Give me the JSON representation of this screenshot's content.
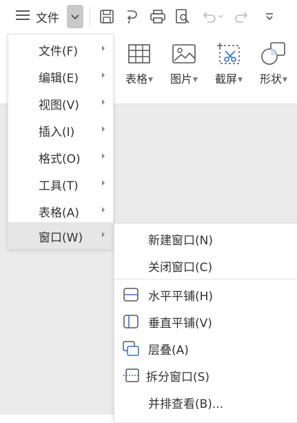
{
  "toolbar": {
    "menu_label": "文件"
  },
  "ribbon": {
    "items": [
      {
        "label": "表格"
      },
      {
        "label": "图片"
      },
      {
        "label": "截屏"
      },
      {
        "label": "形状"
      }
    ]
  },
  "menu": {
    "items": [
      {
        "label": "文件(F)"
      },
      {
        "label": "编辑(E)"
      },
      {
        "label": "视图(V)"
      },
      {
        "label": "插入(I)"
      },
      {
        "label": "格式(O)"
      },
      {
        "label": "工具(T)"
      },
      {
        "label": "表格(A)"
      },
      {
        "label": "窗口(W)"
      }
    ]
  },
  "submenu": {
    "items": [
      {
        "label": "新建窗口(N)"
      },
      {
        "label": "关闭窗口(C)"
      },
      {
        "label": "水平平铺(H)",
        "icon": "horizontal-tile-icon"
      },
      {
        "label": "垂直平铺(V)",
        "icon": "vertical-tile-icon"
      },
      {
        "label": "层叠(A)",
        "icon": "cascade-icon"
      },
      {
        "label": "拆分窗口(S)",
        "icon": "split-window-icon"
      },
      {
        "label": "并排查看(B)..."
      }
    ]
  },
  "colors": {
    "accent": "#2e6fd9",
    "icon": "#555555",
    "menu_active": "#e6e6e6",
    "canvas": "#ebebeb"
  }
}
